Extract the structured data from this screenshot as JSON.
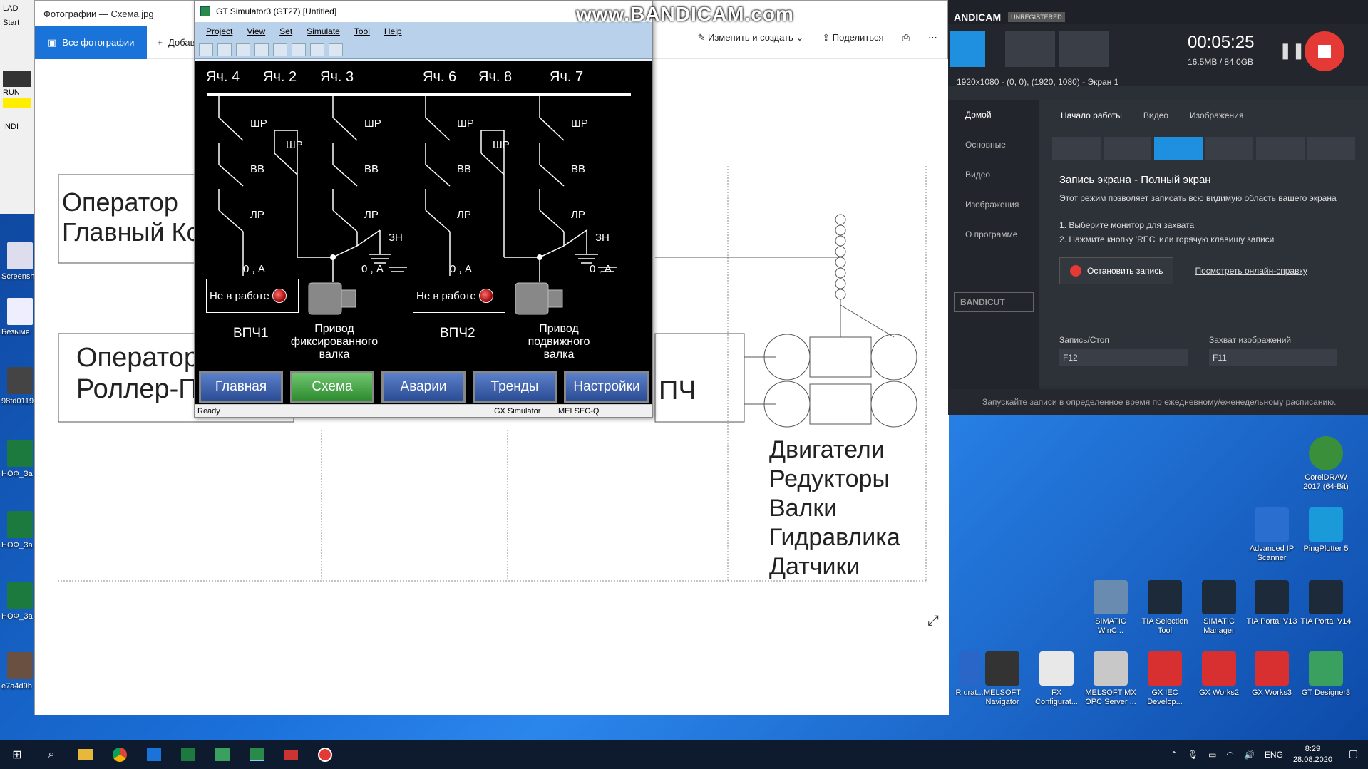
{
  "watermark": "www.BANDICAM.com",
  "lad": {
    "title": "LAD",
    "start": "Start",
    "run": "RUN",
    "indi": "INDI"
  },
  "left_icons": [
    "Screensh",
    "Безымя",
    "98fd0119",
    "НОФ_За",
    "НОФ_За",
    "НОФ_За",
    "e7a4d9b"
  ],
  "photos": {
    "title": "Фотографии — Схема.jpg",
    "all_photos": "Все фотографии",
    "add": "Добавить",
    "edit_create": "Изменить и создать",
    "share": "Поделиться",
    "scheme": {
      "operator1": "Оператор",
      "operator1_line2": "Главный Ко",
      "operator2": "Оператор",
      "operator2_line2": "Роллер-П",
      "pch": "ПЧ",
      "list": [
        "Двигатели",
        "Редукторы",
        "Валки",
        "Гидравлика",
        "Датчики"
      ]
    }
  },
  "gtsim": {
    "title": "GT Simulator3 (GT27)  [Untitled]",
    "menu": [
      "Project",
      "View",
      "Set",
      "Simulate",
      "Tool",
      "Help"
    ],
    "cells": [
      "Яч. 4",
      "Яч. 2",
      "Яч. 3",
      "Яч. 6",
      "Яч. 8",
      "Яч. 7"
    ],
    "switch_labels": {
      "shr": "ШР",
      "vv": "ВВ",
      "lr": "ЛР",
      "zn": "ЗН"
    },
    "current": "0 , А",
    "status_box": "Не в работе",
    "vpch1": "ВПЧ1",
    "vpch2": "ВПЧ2",
    "drive_fixed": [
      "Привод",
      "фиксированного",
      "валка"
    ],
    "drive_moving": [
      "Привод",
      "подвижного",
      "валка"
    ],
    "nav": [
      "Главная",
      "Схема",
      "Аварии",
      "Тренды",
      "Настройки"
    ],
    "status": {
      "ready": "Ready",
      "gx": "GX Simulator",
      "melsec": "MELSEC-Q"
    }
  },
  "bandicam": {
    "brand": "ANDICAM",
    "unregistered": "UNREGISTERED",
    "timer": "00:05:25",
    "size": "16.5MB / 84.0GB",
    "resolution": "1920x1080 - (0, 0), (1920, 1080) - Экран 1",
    "side": [
      "Домой",
      "Основные",
      "Видео",
      "Изображения",
      "О программе"
    ],
    "tabs": [
      "Начало работы",
      "Видео",
      "Изображения"
    ],
    "mode_title": "Запись экрана - Полный экран",
    "mode_desc": "Этот режим позволяет записать всю видимую область вашего экрана",
    "step1": "1. Выберите монитор для захвата",
    "step2": "2. Нажмите кнопку 'REC' или горячую клавишу записи",
    "stop_btn": "Остановить запись",
    "help_link": "Посмотреть онлайн-справку",
    "rec_stop": "Запись/Стоп",
    "rec_key": "F12",
    "capture": "Захват изображений",
    "capture_key": "F11",
    "bandicut": "BANDICUT",
    "schedule": "Запускайте записи в определенное время по ежедневному/еженедельному расписанию."
  },
  "desktop_icons": [
    {
      "label": "CorelDRAW 2017 (64-Bit)",
      "color": "#3a8f3a"
    },
    {
      "label": "Advanced IP Scanner",
      "color": "#2a6fd0"
    },
    {
      "label": "PingPlotter 5",
      "color": "#1a9ad8"
    },
    {
      "label": "SIMATIC WinC...",
      "color": "#6a8bb0"
    },
    {
      "label": "TIA Selection Tool",
      "color": "#1d2a3a"
    },
    {
      "label": "SIMATIC Manager",
      "color": "#1d2a3a"
    },
    {
      "label": "TIA Portal V13",
      "color": "#1d2a3a"
    },
    {
      "label": "TIA Portal V14",
      "color": "#1d2a3a"
    },
    {
      "label": "R urat...",
      "color": "#2a66c8"
    },
    {
      "label": "MELSOFT Navigator",
      "color": "#333"
    },
    {
      "label": "FX Configurat...",
      "color": "#e8e8e8"
    },
    {
      "label": "MELSOFT MX OPC Server ...",
      "color": "#c8c8c8"
    },
    {
      "label": "GX IEC Develop...",
      "color": "#d83030"
    },
    {
      "label": "GX Works2",
      "color": "#d83030"
    },
    {
      "label": "GX Works3",
      "color": "#d83030"
    },
    {
      "label": "GT Designer3",
      "color": "#3aa060"
    }
  ],
  "taskbar": {
    "lang": "ENG",
    "time": "8:29",
    "date": "28.08.2020"
  }
}
